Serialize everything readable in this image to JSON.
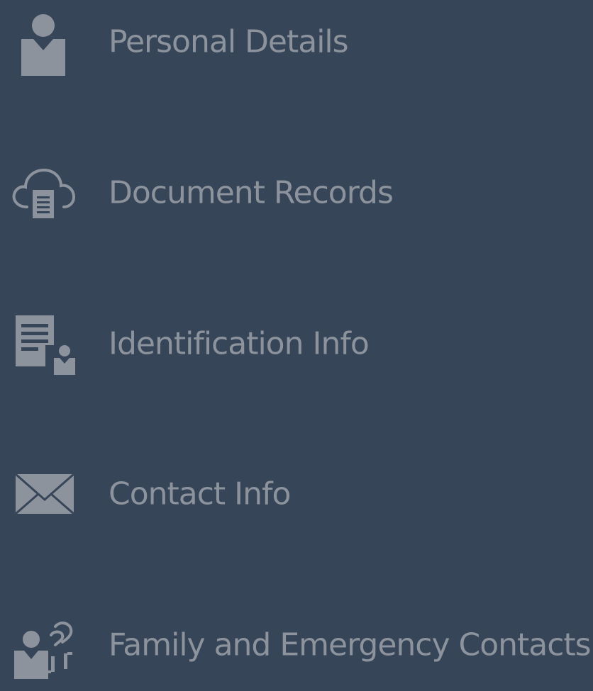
{
  "sidebar": {
    "items": [
      {
        "label": "Personal Details",
        "icon": "person-icon"
      },
      {
        "label": "Document Records",
        "icon": "cloud-document-icon"
      },
      {
        "label": "Identification Info",
        "icon": "id-document-icon"
      },
      {
        "label": "Contact Info",
        "icon": "envelope-icon"
      },
      {
        "label": "Family and Emergency Contacts",
        "icon": "family-contacts-icon"
      }
    ]
  },
  "colors": {
    "background": "#374559",
    "text": "#8c939c",
    "icon": "#8c939c"
  }
}
